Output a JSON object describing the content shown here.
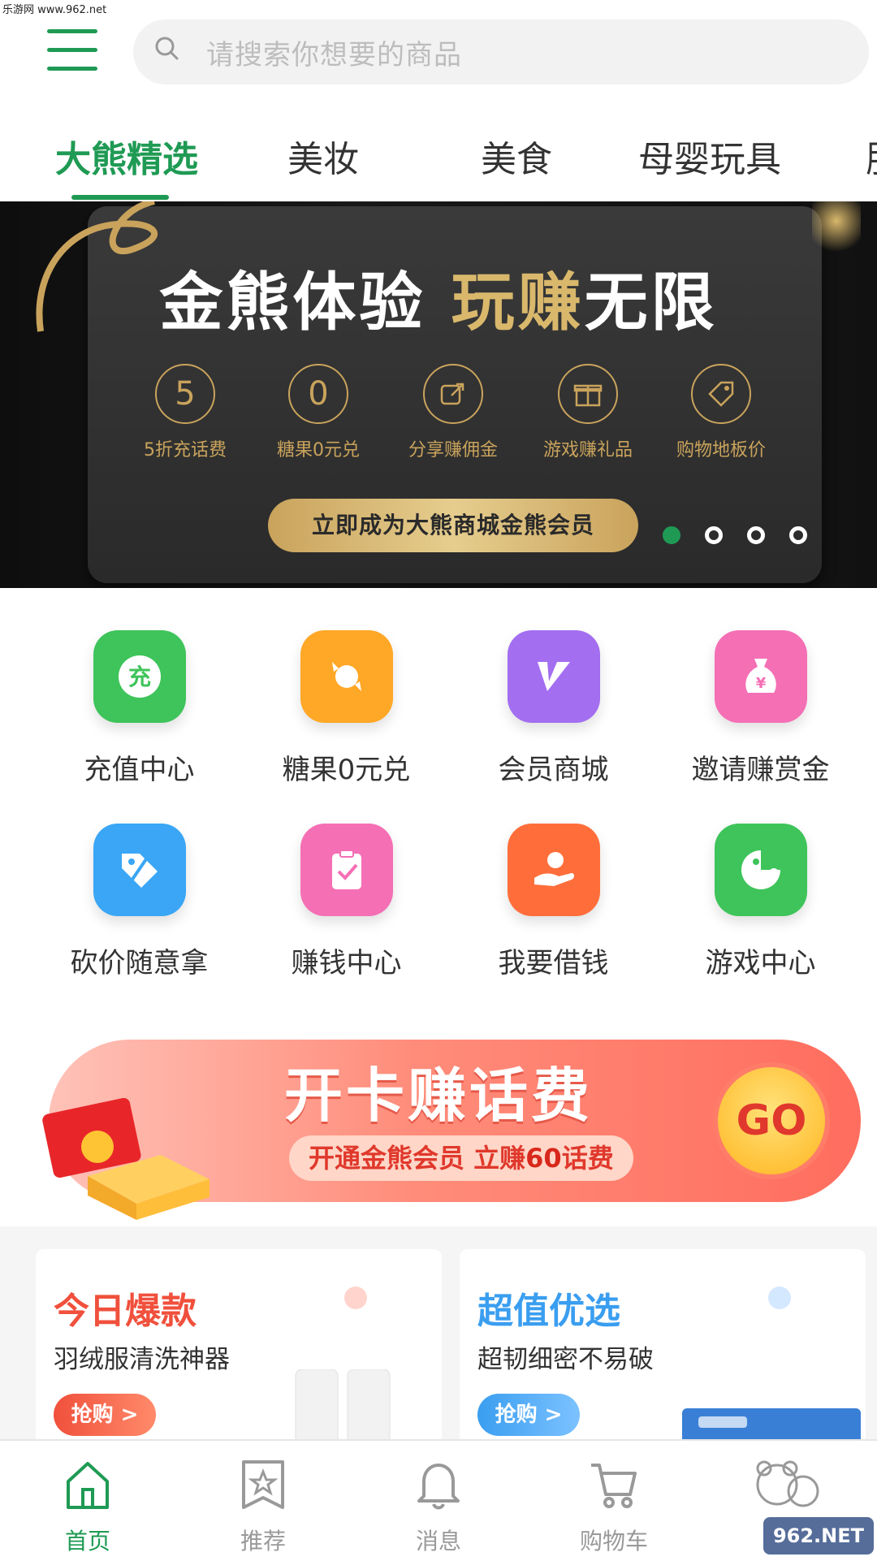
{
  "watermark": "乐游网 www.962.net",
  "header": {
    "search_placeholder": "请搜索你想要的商品"
  },
  "tabs": [
    {
      "label": "大熊精选",
      "active": true
    },
    {
      "label": "美妆"
    },
    {
      "label": "美食"
    },
    {
      "label": "母婴玩具"
    },
    {
      "label": "服"
    }
  ],
  "banner": {
    "title_white_1": "金熊体验",
    "title_gold": "玩赚",
    "title_white_2": "无限",
    "perks": [
      {
        "icon_text": "5",
        "label": "5折充话费"
      },
      {
        "icon_text": "0",
        "label": "糖果0元兑"
      },
      {
        "icon_text": "",
        "label": "分享赚佣金"
      },
      {
        "icon_text": "",
        "label": "游戏赚礼品"
      },
      {
        "icon_text": "",
        "label": "购物地板价"
      }
    ],
    "cta": "立即成为大熊商城金熊会员",
    "slides_total": 4,
    "active_slide": 1
  },
  "grid": [
    {
      "label": "充值中心",
      "icon": "charge-icon",
      "icon_text": "充",
      "color": "#3ec45a"
    },
    {
      "label": "糖果0元兑",
      "icon": "candy-icon",
      "color": "#ffa726"
    },
    {
      "label": "会员商城",
      "icon": "vip-icon",
      "color": "#a36ef0"
    },
    {
      "label": "邀请赚赏金",
      "icon": "money-bag-icon",
      "icon_text": "¥",
      "color": "#f56fb5"
    },
    {
      "label": "砍价随意拿",
      "icon": "tag-icon",
      "color": "#3aa6f5"
    },
    {
      "label": "赚钱中心",
      "icon": "clipboard-icon",
      "color": "#f56fb5"
    },
    {
      "label": "我要借钱",
      "icon": "loan-hand-icon",
      "color": "#ff6e3a"
    },
    {
      "label": "游戏中心",
      "icon": "game-icon",
      "color": "#3ec45a"
    }
  ],
  "promo": {
    "title": "开卡赚话费",
    "sub_prefix": "开通金熊会员 立赚",
    "sub_amount": "60",
    "sub_suffix": "话费",
    "go": "GO"
  },
  "cards": [
    {
      "title": "今日爆款",
      "subtitle": "羽绒服清洗神器",
      "button": "抢购 >",
      "color": "#f0503c"
    },
    {
      "title": "超值优选",
      "subtitle": "超韧细密不易破",
      "button": "抢购 >",
      "color": "#3a9ef0"
    }
  ],
  "bottom_nav": [
    {
      "label": "首页",
      "icon": "home-icon",
      "active": true
    },
    {
      "label": "推荐",
      "icon": "star-bookmark-icon"
    },
    {
      "label": "消息",
      "icon": "bell-icon"
    },
    {
      "label": "购物车",
      "icon": "cart-icon"
    },
    {
      "label": "",
      "icon": "bear-icon"
    }
  ],
  "site_watermark": "962.NET"
}
